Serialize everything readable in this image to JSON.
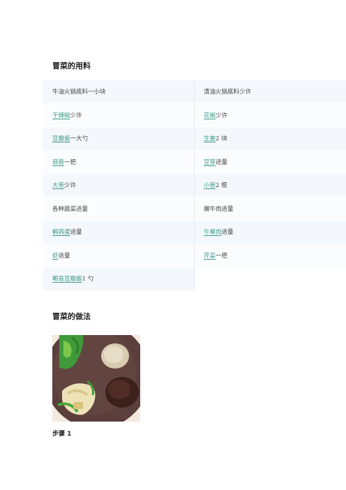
{
  "sections": {
    "ingredients_title": "冒菜的用料",
    "method_title": "冒菜的做法"
  },
  "ingredients": [
    {
      "left": {
        "name": "牛油火锅底料一小块",
        "link": "",
        "amount": ""
      },
      "right": {
        "name": "清油火锅底料少许",
        "link": "",
        "amount": ""
      }
    },
    {
      "left": {
        "name": "",
        "link": "干辣椒",
        "amount": "少许"
      },
      "right": {
        "name": "",
        "link": "花椒",
        "amount": "少许"
      }
    },
    {
      "left": {
        "name": "",
        "link": "豆瓣酱",
        "amount": "一大勺"
      },
      "right": {
        "name": "",
        "link": "生姜",
        "amount": "2 块"
      }
    },
    {
      "left": {
        "name": "",
        "link": "蒜蓉",
        "amount": "一把"
      },
      "right": {
        "name": "",
        "link": "豆芽",
        "amount": "适量"
      }
    },
    {
      "left": {
        "name": "",
        "link": "大葱",
        "amount": "少许"
      },
      "right": {
        "name": "",
        "link": "小葱",
        "amount": "2 根"
      }
    },
    {
      "left": {
        "name": "各种蔬菜适量",
        "link": "",
        "amount": ""
      },
      "right": {
        "name": "嫩牛肉适量",
        "link": "",
        "amount": ""
      }
    },
    {
      "left": {
        "name": "",
        "link": "鹌鹑蛋",
        "amount": "适量"
      },
      "right": {
        "name": "",
        "link": "午餐肉",
        "amount": "适量"
      }
    },
    {
      "left": {
        "name": "",
        "link": "虾",
        "amount": "适量"
      },
      "right": {
        "name": "",
        "link": "芹菜",
        "amount": "一把"
      }
    },
    {
      "left": {
        "name": "",
        "link": "郫县豆瓣酱",
        "amount": "1 勺"
      },
      "right": null
    }
  ],
  "steps": [
    {
      "label": "步骤 1"
    }
  ]
}
